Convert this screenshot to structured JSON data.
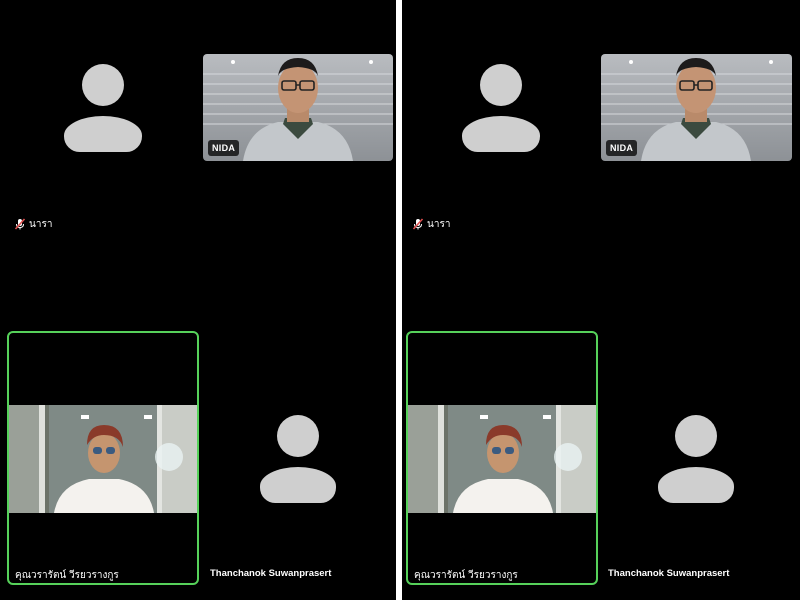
{
  "panels": [
    {
      "id": "left",
      "participants": {
        "top_left": {
          "name": "นารา",
          "muted": true,
          "camera": "off"
        },
        "top_right": {
          "name": "NIDA",
          "camera": "on"
        },
        "bottom_left": {
          "name": "คุณวรารัตน์ วีรยวรางกูร",
          "camera": "on",
          "active_speaker": true
        },
        "bottom_right": {
          "name": "Thanchanok Suwanprasert",
          "camera": "off"
        }
      }
    },
    {
      "id": "right",
      "participants": {
        "top_left": {
          "name": "นารา",
          "muted": true,
          "camera": "off"
        },
        "top_right": {
          "name": "NIDA",
          "camera": "on"
        },
        "bottom_left": {
          "name": "คุณวรารัตน์ วีรยวรางกูร",
          "camera": "on",
          "active_speaker": true
        },
        "bottom_right": {
          "name": "Thanchanok Suwanprasert",
          "camera": "off"
        }
      }
    }
  ],
  "colors": {
    "background": "#000000",
    "active_speaker_border": "#56d15a",
    "avatar_placeholder": "#cfcfcf",
    "muted_mic": "#e05050"
  },
  "icons": [
    "avatar-placeholder-icon",
    "muted-mic-icon"
  ]
}
